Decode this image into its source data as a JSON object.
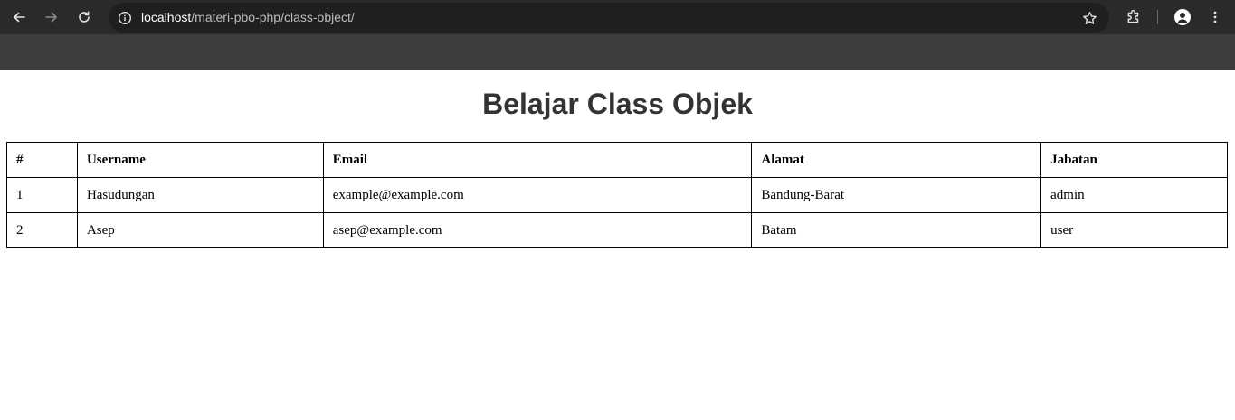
{
  "browser": {
    "url_host": "localhost",
    "url_path": "/materi-pbo-php/class-object/",
    "icons": {
      "back": "arrow-left-icon",
      "forward": "arrow-right-icon",
      "reload": "reload-icon",
      "site_info": "info-icon",
      "bookmark": "star-icon",
      "extensions": "puzzle-icon",
      "profile": "person-icon",
      "menu": "kebab-menu-icon"
    }
  },
  "page": {
    "title": "Belajar Class Objek",
    "table": {
      "headers": [
        "#",
        "Username",
        "Email",
        "Alamat",
        "Jabatan"
      ],
      "rows": [
        [
          "1",
          "Hasudungan",
          "example@example.com",
          "Bandung-Barat",
          "admin"
        ],
        [
          "2",
          "Asep",
          "asep@example.com",
          "Batam",
          "user"
        ]
      ]
    }
  },
  "colors": {
    "toolbar_bg": "#2a2a2a",
    "omnibox_bg": "#1f1f1f",
    "tabstrip_bg": "#3c3c3c",
    "title_text": "#333333"
  }
}
